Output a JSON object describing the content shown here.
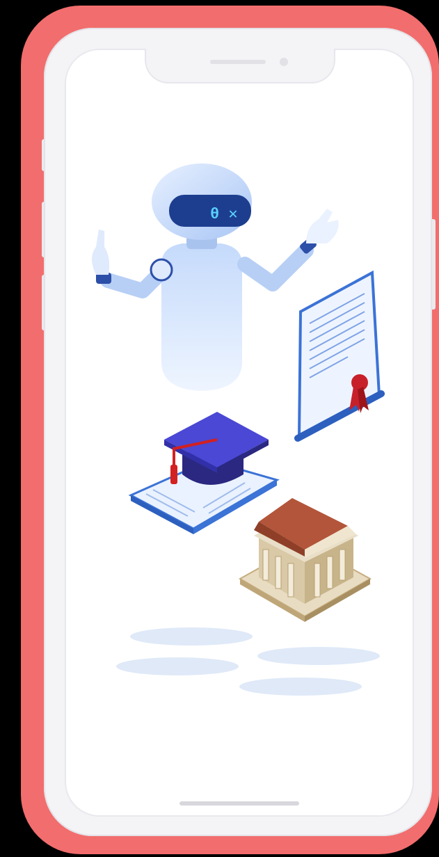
{
  "device": {
    "case_color": "#f26d6d",
    "frame_color": "#f4f4f7",
    "screen_color": "#ffffff"
  },
  "illustration": {
    "robot": {
      "visor_text": "θ ✕",
      "body_color": "#cfe0fb",
      "visor_color": "#1d3e8f",
      "visor_glow": "#5ad3ff"
    },
    "certificate": {
      "paper_color": "#eef4ff",
      "seal_color": "#c8202a"
    },
    "graduation_cap": {
      "cap_color": "#3d3bbf",
      "tassel_color": "#d32020"
    },
    "book": {
      "color": "#eaf2ff"
    },
    "building": {
      "roof_color": "#b3553a",
      "column_color": "#efe5cf"
    },
    "shadow_color": "#dfe9f8"
  }
}
